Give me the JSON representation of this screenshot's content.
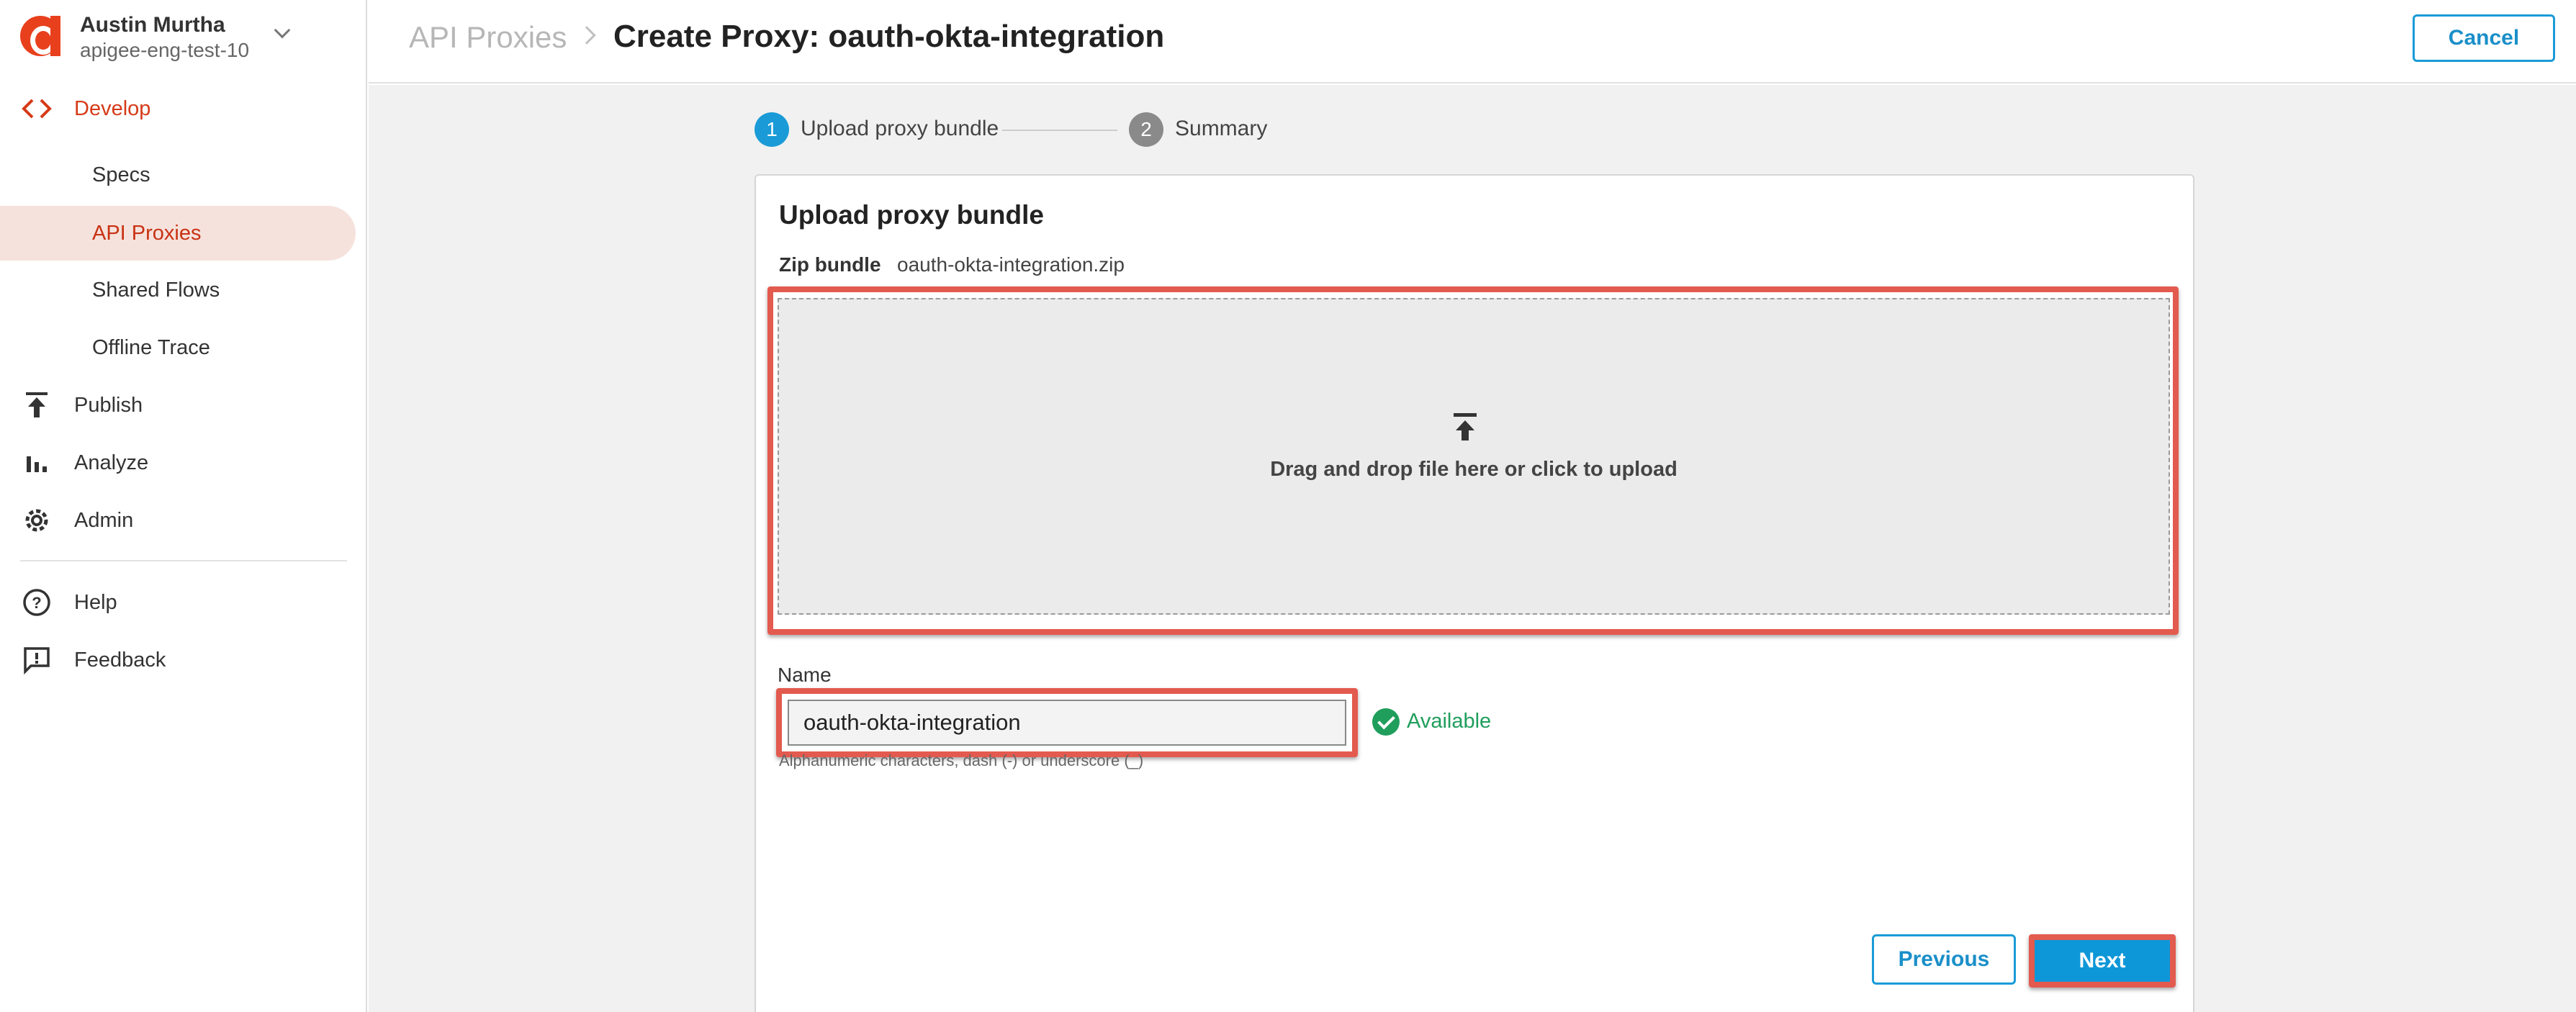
{
  "user": {
    "name": "Austin Murtha",
    "org": "apigee-eng-test-10"
  },
  "sidebar": {
    "develop": "Develop",
    "sub_items": [
      "Specs",
      "API Proxies",
      "Shared Flows",
      "Offline Trace"
    ],
    "publish": "Publish",
    "analyze": "Analyze",
    "admin": "Admin",
    "help": "Help",
    "feedback": "Feedback"
  },
  "header": {
    "breadcrumb": "API Proxies",
    "title": "Create Proxy: oauth-okta-integration",
    "cancel_label": "Cancel"
  },
  "steps": [
    {
      "number": "1",
      "label": "Upload proxy bundle",
      "active": true
    },
    {
      "number": "2",
      "label": "Summary",
      "active": false
    }
  ],
  "card": {
    "title": "Upload proxy bundle",
    "zip_label": "Zip bundle",
    "zip_file": "oauth-okta-integration.zip",
    "drop_text": "Drag and drop file here or click to upload",
    "name_label": "Name",
    "name_value": "oauth-okta-integration",
    "available_text": "Available",
    "hint": "Alphanumeric characters, dash (-) or underscore (_)",
    "previous_label": "Previous",
    "next_label": "Next"
  },
  "colors": {
    "accent": "#e8401d",
    "primary_blue": "#0e97d8",
    "success": "#1f9e5c",
    "highlight": "#e35a4f"
  }
}
